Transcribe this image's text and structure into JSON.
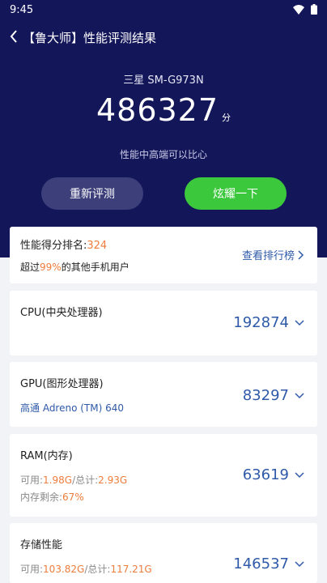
{
  "status_bar": {
    "time": "9:45",
    "icons": [
      "wifi-icon",
      "battery-icon"
    ]
  },
  "app_bar": {
    "title": "【鲁大师】性能评测结果",
    "back_icon": "back-chevron-icon"
  },
  "hero": {
    "device_name": "三星 SM-G973N",
    "score": "486327",
    "score_unit": "分",
    "comment": "性能中高端可以比心",
    "retest_label": "重新评测",
    "share_label": "炫耀一下"
  },
  "rank": {
    "label": "性能得分排名:",
    "value": "324",
    "beat_prefix": "超过",
    "beat_percent": "99%",
    "beat_suffix": "的其他手机用户",
    "link_label": "查看排行榜"
  },
  "items": [
    {
      "title": "CPU(中央处理器)",
      "score": "192874"
    },
    {
      "title": "GPU(图形处理器)",
      "subtitle": "高通 Adreno (TM) 640",
      "score": "83297"
    },
    {
      "title": "RAM(内存)",
      "available_label": "可用:",
      "available_value": "1.98G",
      "total_label": "/总计:",
      "total_value": "2.93G",
      "remaining_label": "内存剩余:",
      "remaining_value": "67%",
      "score": "63619"
    },
    {
      "title": "存储性能",
      "available_label": "可用:",
      "available_value": "103.82G",
      "total_label": "/总计:",
      "total_value": "117.21G",
      "score": "146537"
    }
  ],
  "colors": {
    "hero_bg": "#14165a",
    "accent_green": "#3cc83c",
    "link_blue": "#2e5aa8",
    "highlight_orange": "#ee7c3c"
  }
}
